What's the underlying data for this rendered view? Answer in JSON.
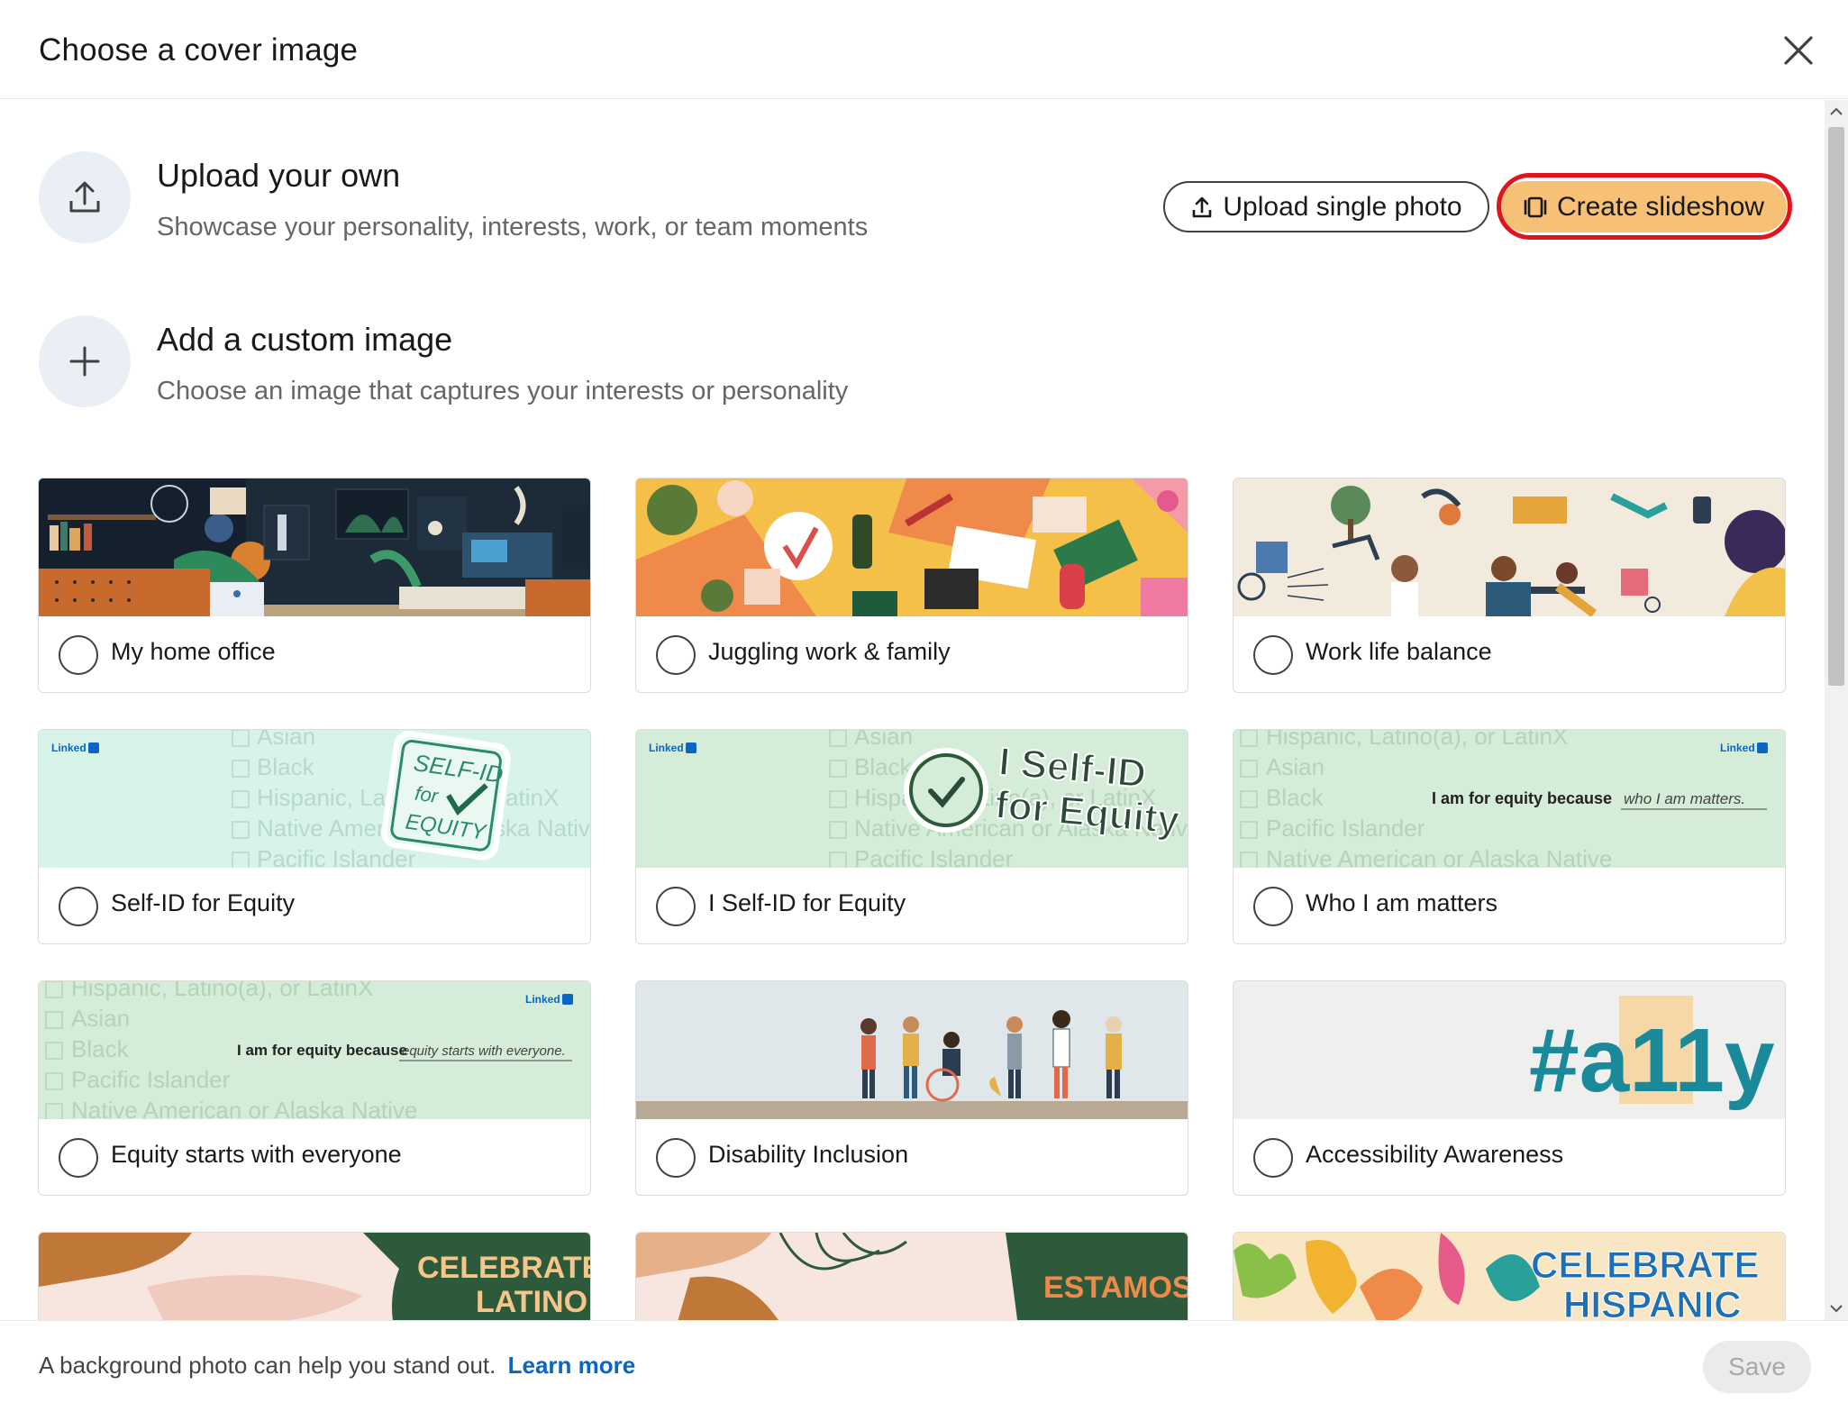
{
  "dialog": {
    "title": "Choose a cover image",
    "close_label": "close"
  },
  "upload_own": {
    "title": "Upload your own",
    "subtitle": "Showcase your personality, interests, work, or team moments",
    "upload_button": "Upload single photo",
    "slideshow_button": "Create slideshow"
  },
  "custom_image": {
    "title": "Add a custom image",
    "subtitle": "Choose an image that captures your interests or personality"
  },
  "cards": [
    {
      "label": "My home office"
    },
    {
      "label": "Juggling work & family"
    },
    {
      "label": "Work life balance"
    },
    {
      "label": "Self-ID for Equity"
    },
    {
      "label": "I Self-ID for Equity"
    },
    {
      "label": "Who I am matters"
    },
    {
      "label": "Equity starts with everyone"
    },
    {
      "label": "Disability Inclusion"
    },
    {
      "label": "Accessibility Awareness"
    }
  ],
  "banner_text": {
    "linkedin": "Linked",
    "linkedin_in": "in",
    "selfid_badge_line1": "SELF-ID",
    "selfid_badge_line2": "for",
    "selfid_badge_line3": "EQUITY",
    "iselfid_line1": "I Self-ID",
    "iselfid_line2": "for Equity",
    "who_prefix": "I am for equity because",
    "who_suffix": "who I am matters.",
    "equity_prefix": "I am for equity because",
    "equity_suffix": "equity starts with everyone.",
    "checkbox_items": [
      "Asian",
      "Black",
      "Hispanic, Latino(a), or LatinX",
      "Native American or Alaska Native",
      "Pacific Islander"
    ],
    "ally": "#a11y",
    "celebrate_latino_1": "CELEBRATE",
    "celebrate_latino_2": "LATINO",
    "estamos": "ESTAMOS",
    "celebrate_hispanic_1": "CELEBRATE",
    "celebrate_hispanic_2": "HISPANIC"
  },
  "footer": {
    "text": "A background photo can help you stand out.",
    "link": "Learn more",
    "save": "Save"
  },
  "colors": {
    "accent_highlight": "#f6c076",
    "annotation_ring": "#e0141e",
    "link": "#0a66c2"
  }
}
